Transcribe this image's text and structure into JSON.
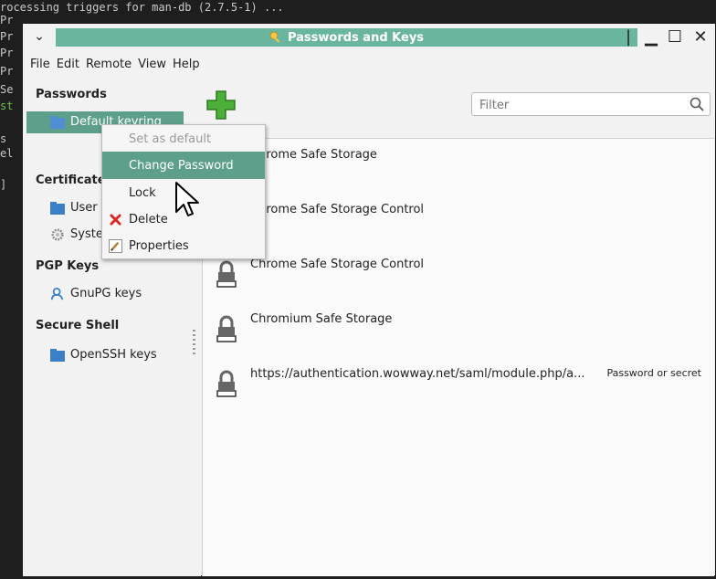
{
  "terminal": {
    "lines": [
      "rocessing triggers for man-db (2.7.5-1) ...",
      "Pr",
      "Pr",
      "Pr",
      "Pr",
      "Se",
      "st",
      "",
      "s",
      "el",
      "",
      "]"
    ]
  },
  "window": {
    "title": "Passwords and Keys",
    "menu_chevron": "⌄",
    "min_glyph": "▁",
    "max_glyph": "☐",
    "close_glyph": "✕",
    "divider_glyph": "|"
  },
  "menubar": [
    "File",
    "Edit",
    "Remote",
    "View",
    "Help"
  ],
  "sidebar": {
    "passwords_heading": "Passwords",
    "default_keyring": "Default keyring",
    "certificates_heading": "Certificates",
    "user_item": "User",
    "system_item": "System",
    "pgp_heading": "PGP Keys",
    "gnupg_item": "GnuPG keys",
    "ssh_heading": "Secure Shell",
    "openssh_item": "OpenSSH keys"
  },
  "filter": {
    "placeholder": "Filter"
  },
  "rows": [
    {
      "name": "Chrome Safe Storage",
      "type": ""
    },
    {
      "name": "Chrome Safe Storage Control",
      "type": ""
    },
    {
      "name": "Chrome Safe Storage Control",
      "type": ""
    },
    {
      "name": "Chromium Safe Storage",
      "type": ""
    },
    {
      "name": "https://authentication.wowway.net/saml/module.php/a...",
      "type": "Password or secret"
    }
  ],
  "context_menu": {
    "set_default": "Set as default",
    "change_password": "Change Password",
    "lock": "Lock",
    "delete": "Delete",
    "properties": "Properties"
  },
  "colors": {
    "accent": "#5d9f8b",
    "title_pill": "#6ab5a0"
  },
  "icons": {
    "add": "plus-icon",
    "search": "search-icon",
    "lock": "lock-icon",
    "folder": "folder-icon",
    "gear": "gear-icon",
    "person": "person-icon",
    "delete": "delete-icon",
    "properties": "pencil-icon",
    "key": "key-icon",
    "cursor": "cursor-icon"
  }
}
